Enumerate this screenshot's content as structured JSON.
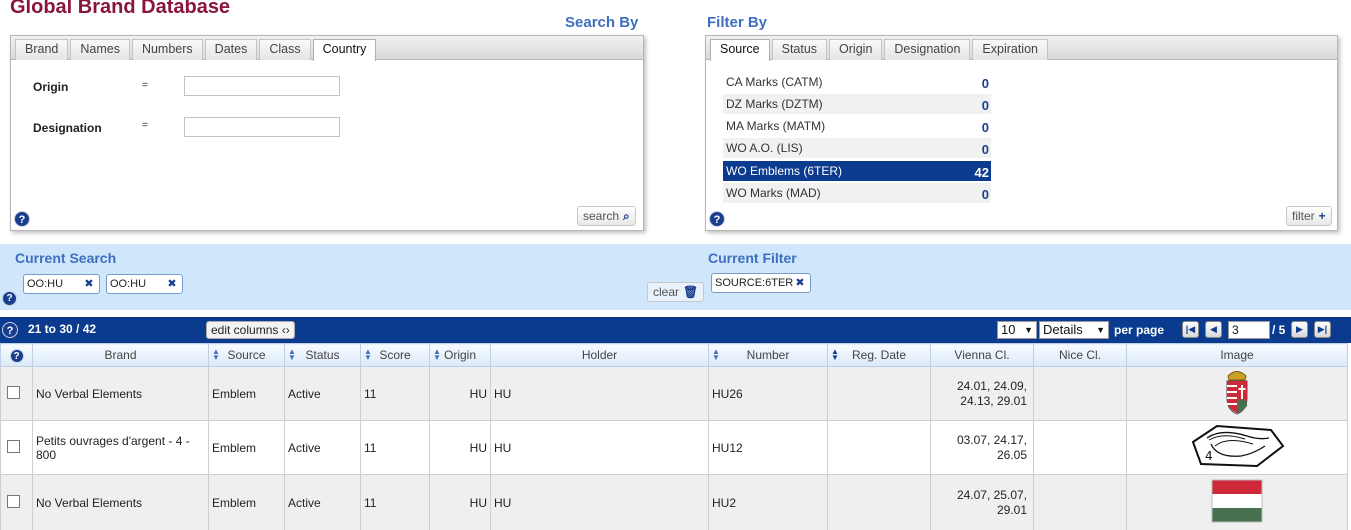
{
  "app": {
    "title": "Global Brand Database"
  },
  "search_by": {
    "heading": "Search By",
    "tabs": [
      "Brand",
      "Names",
      "Numbers",
      "Dates",
      "Class",
      "Country"
    ],
    "active_tab": "Country",
    "fields": [
      {
        "label": "Origin",
        "operator": "=",
        "value": ""
      },
      {
        "label": "Designation",
        "operator": "=",
        "value": ""
      }
    ],
    "help": "?",
    "search_button": "search"
  },
  "filter_by": {
    "heading": "Filter By",
    "tabs": [
      "Source",
      "Status",
      "Origin",
      "Designation",
      "Expiration"
    ],
    "active_tab": "Source",
    "sources": [
      {
        "name": "CA Marks (CATM)",
        "count": "0"
      },
      {
        "name": "DZ Marks (DZTM)",
        "count": "0"
      },
      {
        "name": "MA Marks (MATM)",
        "count": "0"
      },
      {
        "name": "WO A.O. (LIS)",
        "count": "0"
      },
      {
        "name": "WO Emblems (6TER)",
        "count": "42"
      },
      {
        "name": "WO Marks (MAD)",
        "count": "0"
      }
    ],
    "selected_source": "WO Emblems (6TER)",
    "help": "?",
    "filter_button": "filter"
  },
  "current_search": {
    "heading": "Current Search",
    "chips": [
      "OO:HU",
      "OO:HU"
    ],
    "help": "?",
    "clear_button": "clear"
  },
  "current_filter": {
    "heading": "Current Filter",
    "chips": [
      "SOURCE:6TER"
    ]
  },
  "results": {
    "help": "?",
    "range": "21 to 30 / 42",
    "edit_columns": "edit columns",
    "rows_per_page": "10",
    "view_mode": "Details",
    "per_page_label": "per page",
    "page": "3",
    "total_pages": "/ 5"
  },
  "table": {
    "help": "?",
    "columns": [
      "Brand",
      "Source",
      "Status",
      "Score",
      "Origin",
      "Holder",
      "Number",
      "Reg. Date",
      "Vienna Cl.",
      "Nice Cl.",
      "Image"
    ],
    "rows": [
      {
        "brand": "No Verbal Elements",
        "source": "Emblem",
        "status": "Active",
        "score": "11",
        "origin": "HU",
        "holder": "HU",
        "number": "HU26",
        "reg_date": "",
        "vienna": "24.01, 24.09, 24.13, 29.01",
        "nice": "",
        "image": "coat-of-arms"
      },
      {
        "brand": "Petits ouvrages d'argent - 4 - 800",
        "source": "Emblem",
        "status": "Active",
        "score": "11",
        "origin": "HU",
        "holder": "HU",
        "number": "HU12",
        "reg_date": "",
        "vienna": "03.07, 24.17, 26.05",
        "nice": "",
        "image": "hallmark-swan-4"
      },
      {
        "brand": "No Verbal Elements",
        "source": "Emblem",
        "status": "Active",
        "score": "11",
        "origin": "HU",
        "holder": "HU",
        "number": "HU2",
        "reg_date": "",
        "vienna": "24.07, 25.07, 29.01",
        "nice": "",
        "image": "flag-hungary"
      }
    ]
  },
  "colors": {
    "title": "#8a1538",
    "heading": "#3f6fbf",
    "navy": "#0b3b8f",
    "band": "#cfe6fb",
    "flag_red": "#ce2939",
    "flag_green": "#477050"
  }
}
